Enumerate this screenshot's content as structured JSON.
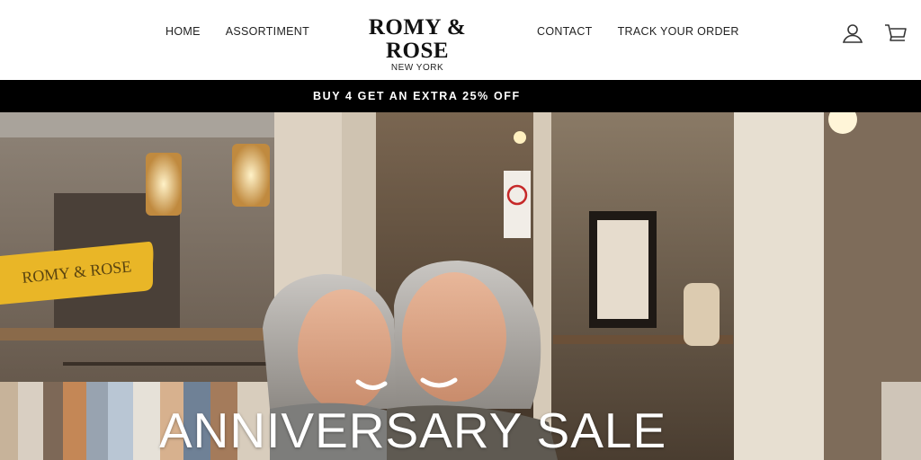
{
  "header": {
    "nav_left": [
      "HOME",
      "ASSORTIMENT"
    ],
    "nav_right": [
      "CONTACT",
      "TRACK YOUR ORDER"
    ],
    "logo": {
      "main": "ROMY & ROSE",
      "sub": "NEW YORK"
    },
    "icons": {
      "account": "account-icon",
      "cart": "cart-icon"
    }
  },
  "announcement": {
    "text": "BUY 4 GET AN EXTRA 25% OFF"
  },
  "hero": {
    "title": "ANNIVERSARY SALE",
    "storefront_sign": "ROMY & ROSE"
  },
  "colors": {
    "announcement_bg": "#000000",
    "hero_text": "#ffffff",
    "sign": "#e9b627"
  }
}
